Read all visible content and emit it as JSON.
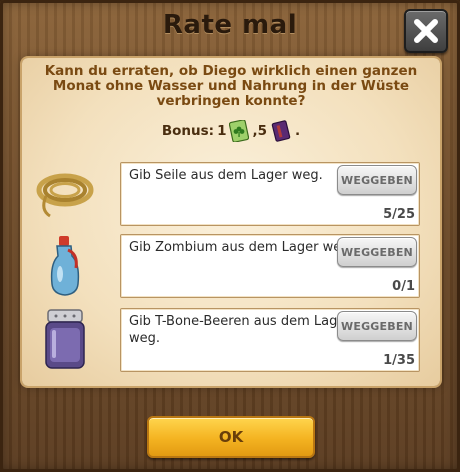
{
  "dialog": {
    "title": "Rate mal",
    "description": "Kann du erraten, ob Diego wirklich einen ganzen Monat ohne Wasser und Nahrung in der Wüste verbringen konnte?",
    "bonus_label": "Bonus:",
    "bonus_amount_1": "1",
    "bonus_amount_2": ",5",
    "bonus_suffix": ".",
    "bonus_icon_1": "clover-card-icon",
    "bonus_icon_2": "purple-book-icon"
  },
  "tasks": [
    {
      "text": "Gib Seile aus dem Lager weg.",
      "button": "WEGGEBEN",
      "progress": "5/25",
      "icon": "rope-icon"
    },
    {
      "text": "Gib Zombium aus dem Lager weg.",
      "button": "WEGGEBEN",
      "progress": "0/1",
      "icon": "potion-bottle-icon"
    },
    {
      "text": "Gib T-Bone-Beeren aus dem Lager weg.",
      "button": "WEGGEBEN",
      "progress": "1/35",
      "icon": "berry-jar-icon"
    }
  ],
  "buttons": {
    "ok": "OK"
  },
  "colors": {
    "accent": "#f4b321",
    "description_text": "#7a4a12",
    "wood": "#6d4a28",
    "parchment": "#f3e0bd"
  }
}
